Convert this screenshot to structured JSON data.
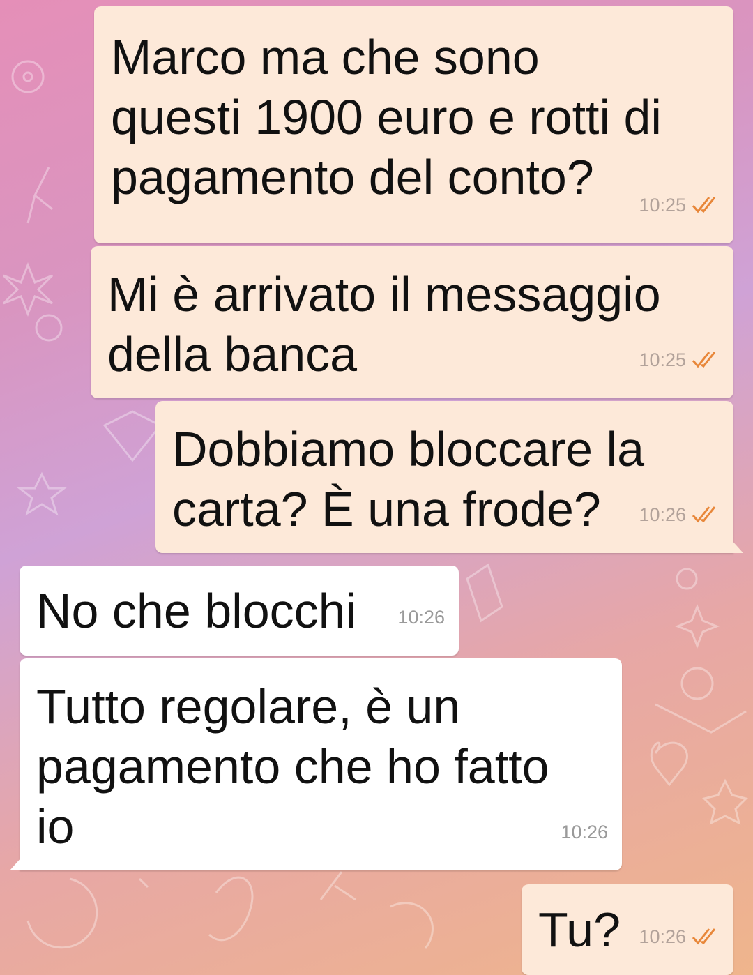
{
  "messages": [
    {
      "text": "Marco ma che sono\nquesti 1900 euro e rotti di\npagamento del conto?",
      "time": "10:25",
      "direction": "outgoing",
      "status": "read"
    },
    {
      "text": "Mi è arrivato il messaggio\ndella banca",
      "time": "10:25",
      "direction": "outgoing",
      "status": "read"
    },
    {
      "text": "Dobbiamo bloccare la\ncarta? È una frode?",
      "time": "10:26",
      "direction": "outgoing",
      "status": "read"
    },
    {
      "text": "No che blocchi",
      "time": "10:26",
      "direction": "incoming"
    },
    {
      "text": "Tutto regolare, è un\npagamento che ho fatto\nio",
      "time": "10:26",
      "direction": "incoming"
    },
    {
      "text": "Tu?",
      "time": "10:26",
      "direction": "outgoing",
      "status": "read"
    }
  ],
  "colors": {
    "outgoing_bubble": "#fde9d9",
    "incoming_bubble": "#ffffff",
    "read_ticks": "#e8873a"
  },
  "icons": {
    "read_status": "double-check-icon"
  }
}
